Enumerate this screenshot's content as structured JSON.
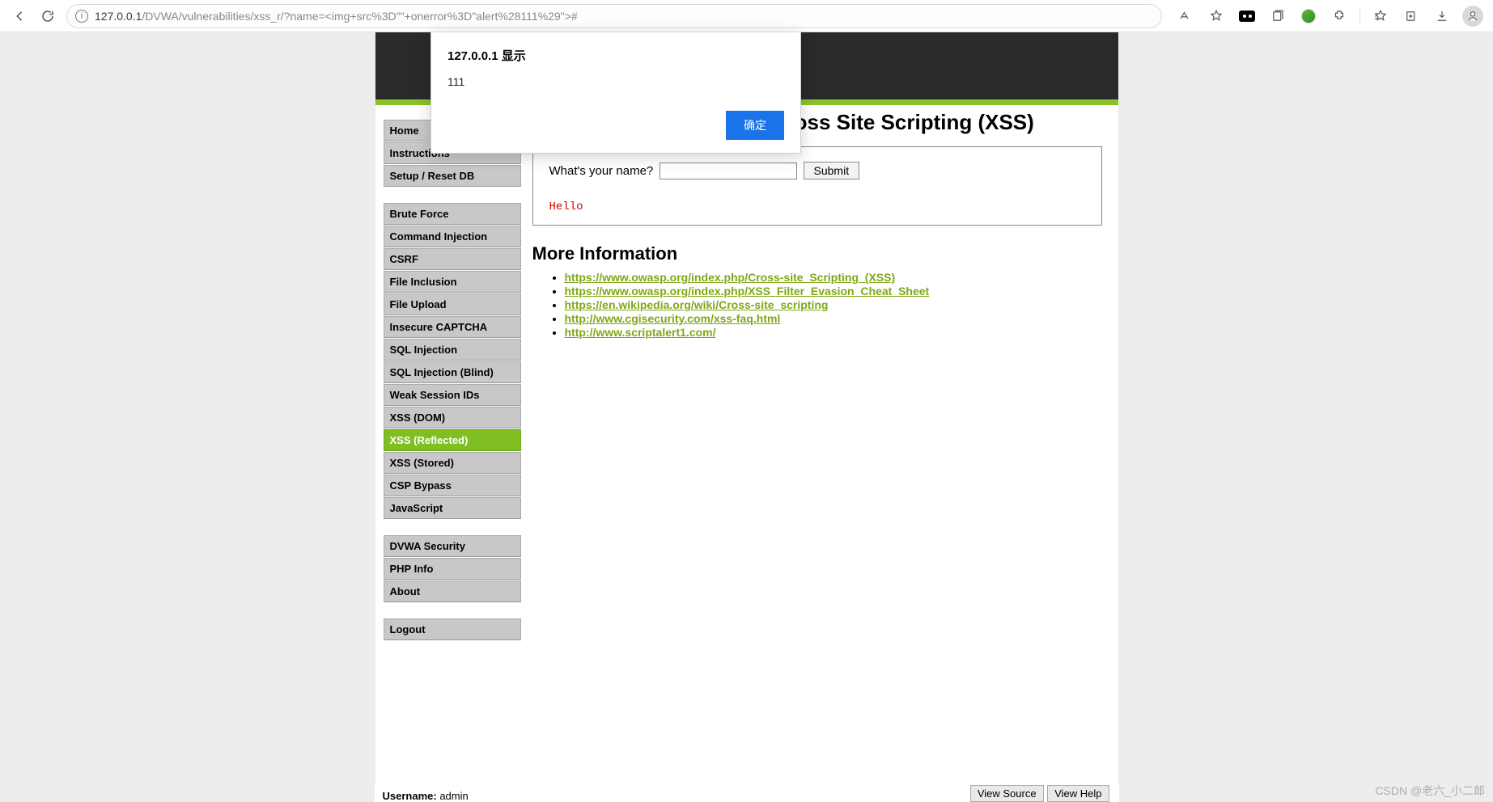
{
  "browser": {
    "url_host": "127.0.0.1",
    "url_path": "/DVWA/vulnerabilities/xss_r/?name=<img+src%3D\"\"+onerror%3D\"alert%28111%29\">#"
  },
  "dialog": {
    "title": "127.0.0.1 显示",
    "message": "111",
    "ok_label": "确定"
  },
  "sidebar": {
    "group1": [
      {
        "label": "Home",
        "name": "home"
      },
      {
        "label": "Instructions",
        "name": "instructions"
      },
      {
        "label": "Setup / Reset DB",
        "name": "setup"
      }
    ],
    "group2": [
      {
        "label": "Brute Force",
        "name": "brute-force"
      },
      {
        "label": "Command Injection",
        "name": "command-injection"
      },
      {
        "label": "CSRF",
        "name": "csrf"
      },
      {
        "label": "File Inclusion",
        "name": "file-inclusion"
      },
      {
        "label": "File Upload",
        "name": "file-upload"
      },
      {
        "label": "Insecure CAPTCHA",
        "name": "insecure-captcha"
      },
      {
        "label": "SQL Injection",
        "name": "sql-injection"
      },
      {
        "label": "SQL Injection (Blind)",
        "name": "sql-injection-blind"
      },
      {
        "label": "Weak Session IDs",
        "name": "weak-session"
      },
      {
        "label": "XSS (DOM)",
        "name": "xss-dom"
      },
      {
        "label": "XSS (Reflected)",
        "name": "xss-reflected",
        "active": true
      },
      {
        "label": "XSS (Stored)",
        "name": "xss-stored"
      },
      {
        "label": "CSP Bypass",
        "name": "csp-bypass"
      },
      {
        "label": "JavaScript",
        "name": "javascript"
      }
    ],
    "group3": [
      {
        "label": "DVWA Security",
        "name": "dvwa-security"
      },
      {
        "label": "PHP Info",
        "name": "php-info"
      },
      {
        "label": "About",
        "name": "about"
      }
    ],
    "group4": [
      {
        "label": "Logout",
        "name": "logout"
      }
    ]
  },
  "page": {
    "title": "Vulnerability: Reflected Cross Site Scripting (XSS)",
    "form_label": "What's your name?",
    "submit_label": "Submit",
    "hello_text": "Hello",
    "more_title": "More Information",
    "links": [
      "https://www.owasp.org/index.php/Cross-site_Scripting_(XSS)",
      "https://www.owasp.org/index.php/XSS_Filter_Evasion_Cheat_Sheet",
      "https://en.wikipedia.org/wiki/Cross-site_scripting",
      "http://www.cgisecurity.com/xss-faq.html",
      "http://www.scriptalert1.com/"
    ]
  },
  "footer": {
    "username_label": "Username:",
    "username_value": "admin",
    "view_source": "View Source",
    "view_help": "View Help"
  },
  "watermark": "CSDN @老六_小二郎"
}
